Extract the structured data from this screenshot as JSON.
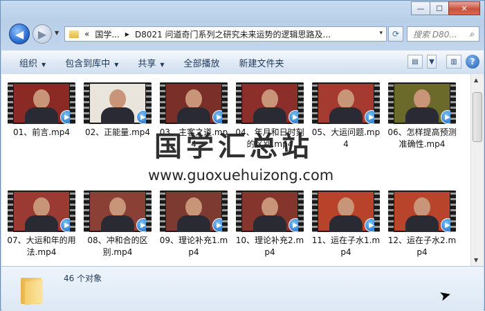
{
  "window": {
    "minimize": "—",
    "maximize": "☐",
    "close": "✕"
  },
  "address": {
    "prefix": "«",
    "crumb1": "国学...",
    "sep": "▶",
    "crumb2": "D8021 问道奇门系列之研究未来运势的逻辑思路及...",
    "dropdown": "▾"
  },
  "search": {
    "placeholder": "搜索 D80..."
  },
  "toolbar": {
    "organize": "组织",
    "include_library": "包含到库中",
    "share": "共享",
    "play_all": "全部播放",
    "new_folder": "新建文件夹"
  },
  "files": [
    {
      "label": "01、前言.mp4",
      "color": "#8b2a25"
    },
    {
      "label": "02、正能量.mp4",
      "color": "#e9e4dc"
    },
    {
      "label": "03、主客之道.mp4",
      "color": "#7a3028"
    },
    {
      "label": "04、年月和日时刻的区别.mp4",
      "color": "#8c2f2a"
    },
    {
      "label": "05、大运问题.mp4",
      "color": "#a43a30"
    },
    {
      "label": "06、怎样提高预测准确性.mp4",
      "color": "#6b6a2a"
    },
    {
      "label": "07、大运和年的用法.mp4",
      "color": "#9a3a32"
    },
    {
      "label": "08、冲和合的区别.mp4",
      "color": "#8a4035"
    },
    {
      "label": "09、理论补充1.mp4",
      "color": "#7d3a30"
    },
    {
      "label": "10、理论补充2.mp4",
      "color": "#86352c"
    },
    {
      "label": "11、运在子水1.mp4",
      "color": "#b9432a"
    },
    {
      "label": "12、运在子水2.mp4",
      "color": "#b8452b"
    }
  ],
  "status": {
    "count": "46 个对象"
  },
  "watermark": {
    "cn": "国学汇总站",
    "url": "www.guoxuehuizong.com"
  }
}
